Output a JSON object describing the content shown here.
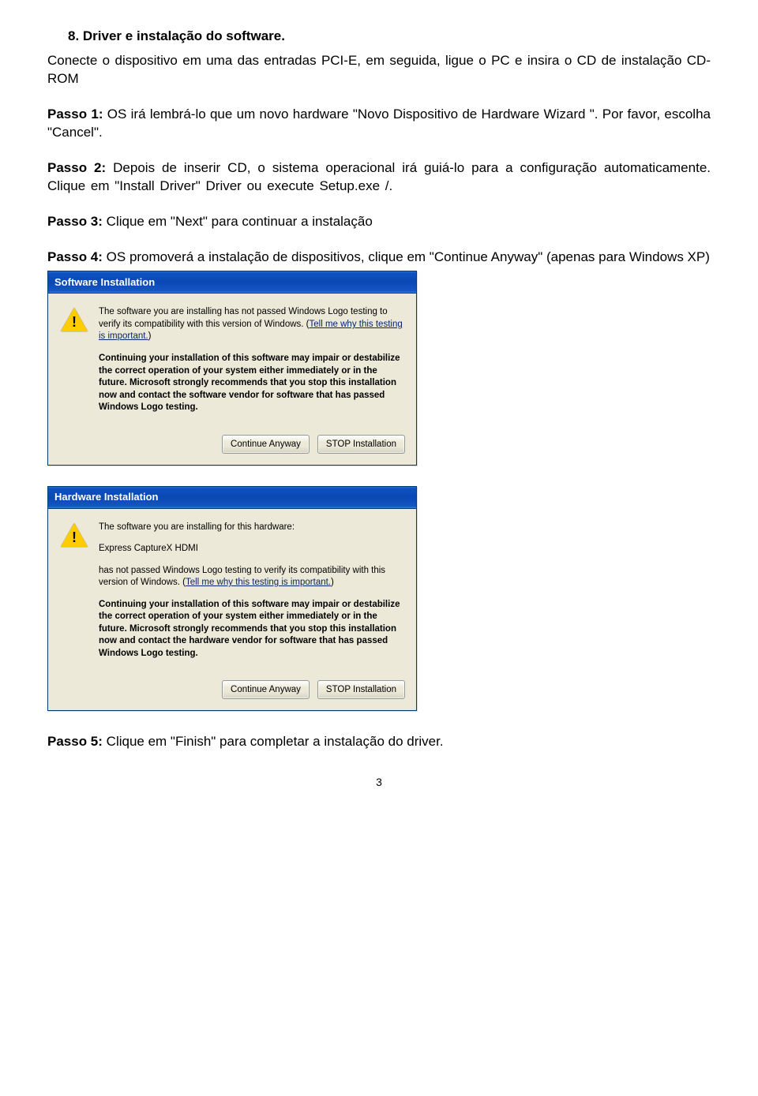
{
  "section_title": "8.  Driver e instalação do software.",
  "intro": "Conecte o dispositivo em uma das entradas PCI-E, em seguida, ligue o PC e insira o CD de instalação CD-ROM",
  "passo1_label": "Passo 1:",
  "passo1_text": " OS irá lembrá-lo que um novo hardware \"Novo Dispositivo de Hardware Wizard \". Por favor, escolha \"Cancel\".",
  "passo2_label": "Passo 2:",
  "passo2_text": " Depois de inserir CD, o sistema operacional irá guiá-lo para a configuração automaticamente. Clique em \"Install Driver\" Driver ou execute Setup.exe /.",
  "passo3_label": "Passo 3:",
  "passo3_text": " Clique em \"Next\" para continuar a instalação",
  "passo4_label": "Passo 4:",
  "passo4_text": " OS promoverá a instalação de dispositivos, clique em \"Continue Anyway\" (apenas para Windows XP)",
  "passo5_label": "Passo 5:",
  "passo5_text": " Clique em \"Finish\" para completar a instalação do driver.",
  "page_number": "3",
  "dialog1": {
    "title": "Software Installation",
    "p1a": "The software you are installing has not passed Windows Logo testing to verify its compatibility with this version of Windows. (",
    "p1link": "Tell me why this testing is important.",
    "p1b": ")",
    "p2": "Continuing your installation of this software may impair or destabilize the correct operation of your system either immediately or in the future. Microsoft strongly recommends that you stop this installation now and contact the software vendor for software that has passed Windows Logo testing.",
    "btn_continue": "Continue Anyway",
    "btn_stop": "STOP Installation"
  },
  "dialog2": {
    "title": "Hardware Installation",
    "p0": "The software you are installing for this hardware:",
    "device": "Express CaptureX HDMI",
    "p1a": "has not passed Windows Logo testing to verify its compatibility with this version of Windows. (",
    "p1link": "Tell me why this testing is important.",
    "p1b": ")",
    "p2": "Continuing your installation of this software may impair or destabilize the correct operation of your system either immediately or in the future. Microsoft strongly recommends that you stop this installation now and contact the hardware vendor for software that has passed Windows Logo testing.",
    "btn_continue": "Continue Anyway",
    "btn_stop": "STOP Installation"
  }
}
